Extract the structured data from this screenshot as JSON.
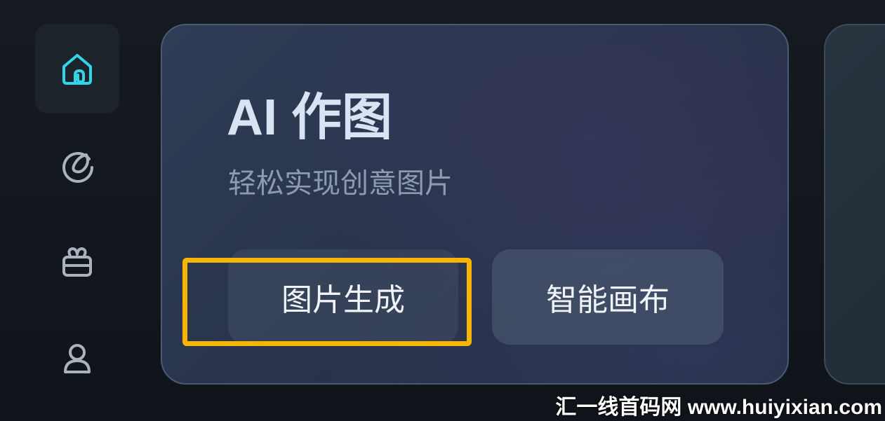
{
  "sidebar": {
    "items": [
      {
        "icon": "home-icon",
        "active": true
      },
      {
        "icon": "spiral-icon",
        "active": false
      },
      {
        "icon": "gift-icon",
        "active": false
      },
      {
        "icon": "user-icon",
        "active": false
      }
    ],
    "colors": {
      "active_icon": "#2fd6e8",
      "inactive_icon": "#a9b3bd"
    }
  },
  "card": {
    "title": "AI 作图",
    "subtitle": "轻松实现创意图片",
    "buttons": {
      "generate_label": "图片生成",
      "canvas_label": "智能画布"
    }
  },
  "highlight": {
    "color": "#f7b500"
  },
  "watermark": {
    "text": "汇一线首码网 www.huiyixian.com"
  }
}
